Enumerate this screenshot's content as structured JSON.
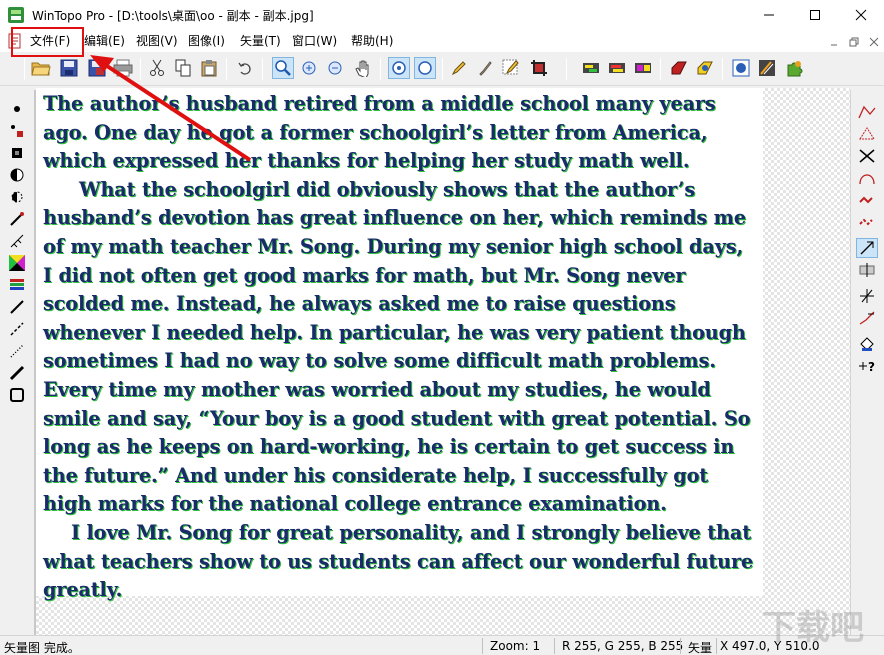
{
  "window": {
    "title": "WinTopo Pro - [D:\\tools\\桌面\\oo - 副本 - 副本.jpg]"
  },
  "menu": {
    "items": [
      "文件(F)",
      "编辑(E)",
      "视图(V)",
      "图像(I)",
      "矢量(T)",
      "窗口(W)",
      "帮助(H)"
    ]
  },
  "document": {
    "paragraphs": [
      "The author’s husband retired from a middle school many years ago. One day he got a former schoolgirl’s letter from America, which expressed her thanks for helping her study math well.",
      "What the schoolgirl did obviously shows that the author’s husband’s devotion has great influence on her, which reminds me of my math teacher Mr. Song. During my senior high school days, I did not often get good marks for math, but Mr. Song never scolded me. Instead, he always asked me to raise questions whenever I needed help. In particular, he was very patient though sometimes I had no way to solve some difficult math problems. Every time my mother was worried about my studies, he would smile and say, “Your boy is a good student with great potential. So long as he keeps on hard-working, he is certain to get success in the future.” And under his considerate help, I successfully got high marks for the national college entrance examination.",
      "I love Mr. Song for great personality, and I strongly believe that what teachers show to us students can affect our wonderful future greatly."
    ]
  },
  "status": {
    "message": "矢量图 完成。",
    "zoom": "Zoom: 1",
    "rgb": "R 255, G 255, B 255",
    "mode": "矢量",
    "coords": "X 497.0, Y 510.0"
  },
  "watermark": {
    "text": "下载吧"
  },
  "colors": {
    "highlight": "#e01010",
    "text_fill": "#1a2a6a",
    "text_edge": "#2fbf3a"
  }
}
